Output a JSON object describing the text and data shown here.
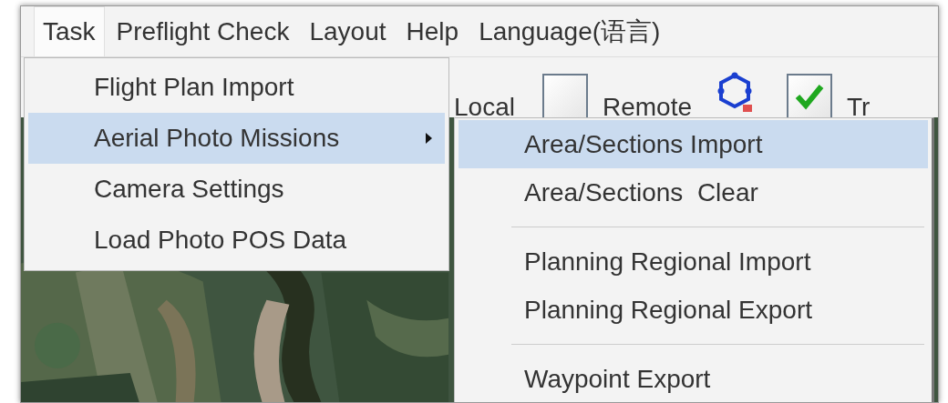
{
  "menubar": [
    {
      "label": "Task",
      "selected": true
    },
    {
      "label": "Preflight Check",
      "selected": false
    },
    {
      "label": "Layout",
      "selected": false
    },
    {
      "label": "Help",
      "selected": false
    },
    {
      "label": "Language(语言)",
      "selected": false
    }
  ],
  "toolbar": [
    {
      "kind": "text",
      "label": "Local"
    },
    {
      "kind": "checkbox",
      "label": "Remote",
      "checked": false
    },
    {
      "kind": "icon"
    },
    {
      "kind": "checkbox",
      "label": "Tr",
      "checked": true
    }
  ],
  "task_menu": {
    "items": [
      {
        "label": "Flight Plan Import",
        "selected": false,
        "has_submenu": false
      },
      {
        "label": "Aerial Photo Missions",
        "selected": true,
        "has_submenu": true
      },
      {
        "label": "Camera Settings",
        "selected": false,
        "has_submenu": false
      },
      {
        "label": "Load Photo POS Data",
        "selected": false,
        "has_submenu": false
      }
    ]
  },
  "submenu": {
    "items": [
      {
        "kind": "item",
        "label": "Area/Sections Import",
        "selected": true
      },
      {
        "kind": "item",
        "label": "Area/Sections  Clear",
        "selected": false
      },
      {
        "kind": "separator"
      },
      {
        "kind": "item",
        "label": "Planning Regional Import",
        "selected": false
      },
      {
        "kind": "item",
        "label": "Planning Regional Export",
        "selected": false
      },
      {
        "kind": "separator"
      },
      {
        "kind": "item",
        "label": "Waypoint Export",
        "selected": false
      }
    ]
  }
}
